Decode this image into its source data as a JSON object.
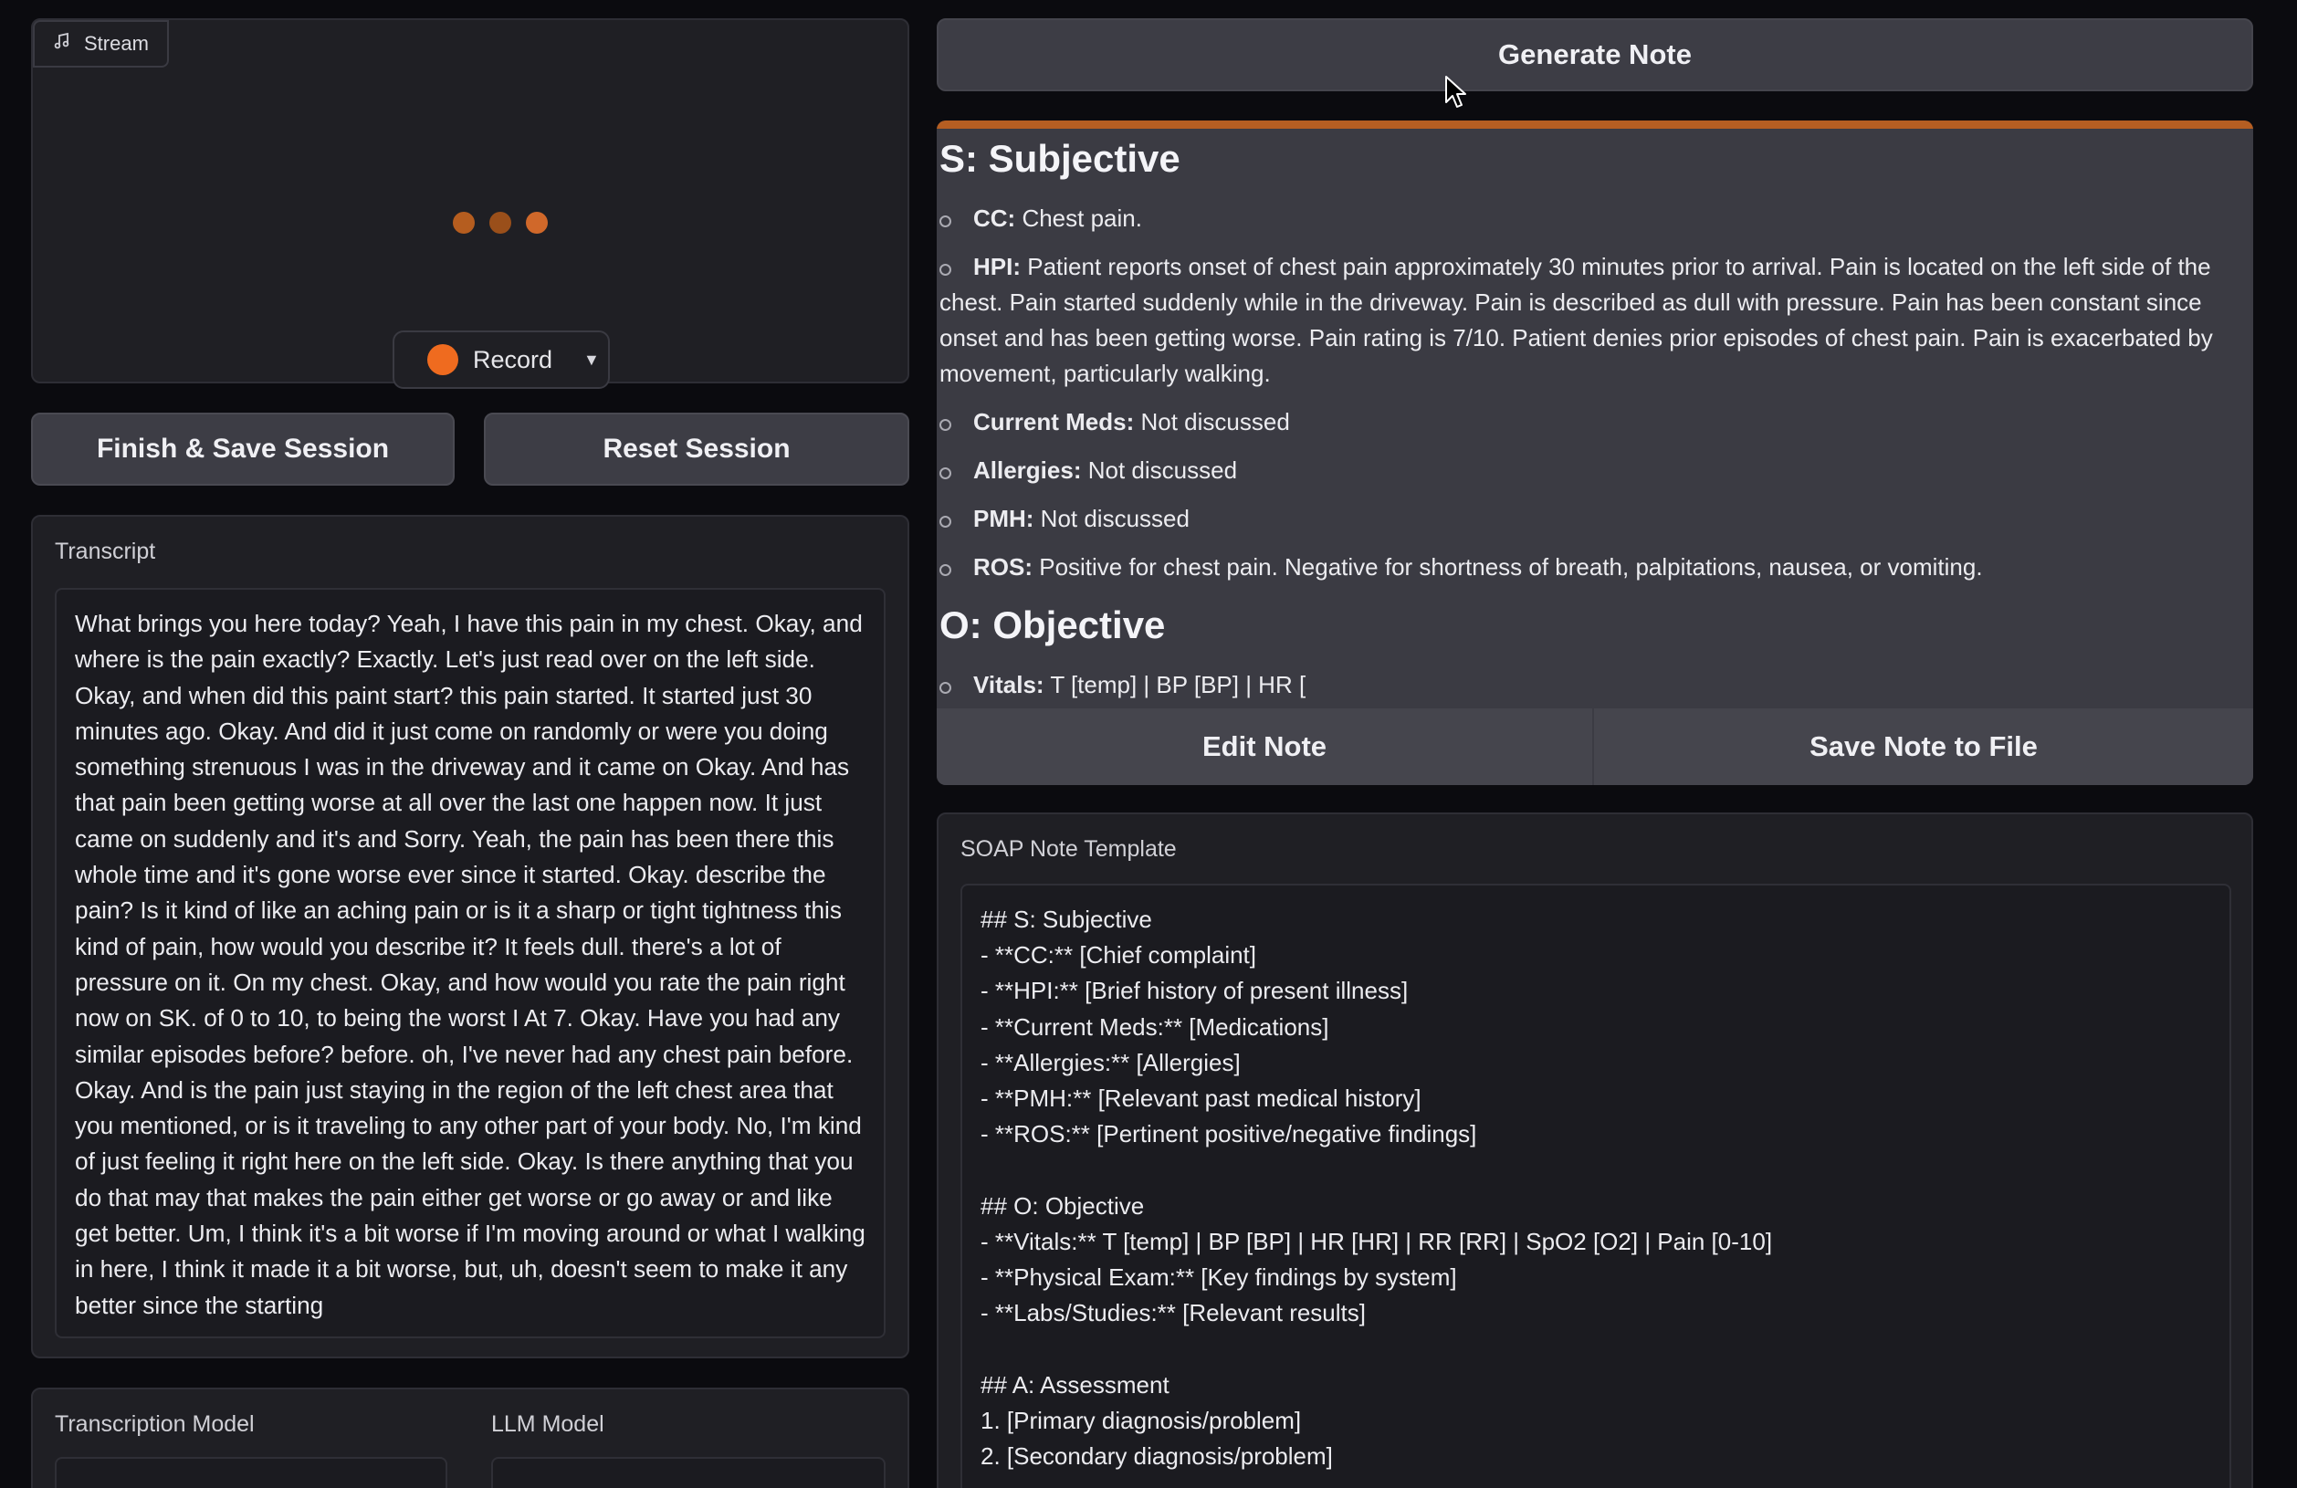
{
  "stream": {
    "tab_label": "Stream",
    "tab_icon": "music-note-icon",
    "record_label": "Record",
    "record_color": "#ef6b1f"
  },
  "session": {
    "finish_label": "Finish & Save Session",
    "reset_label": "Reset Session"
  },
  "transcript": {
    "label": "Transcript",
    "text": "What brings you here today? Yeah, I have this pain in my chest. Okay, and where is the pain exactly? Exactly. Let's just read over on the left side. Okay, and when did this paint start? this pain started. It started just 30 minutes ago. Okay. And did it just come on randomly or were you doing something strenuous I was in the driveway and it came on Okay. And has that pain been getting worse at all over the last one happen now. It just came on suddenly and it's and Sorry. Yeah, the pain has been there this whole time and it's gone worse ever since it started. Okay. describe the pain? Is it kind of like an aching pain or is it a sharp or tight tightness this kind of pain, how would you describe it? It feels dull. there's a lot of pressure on it. On my chest. Okay, and how would you rate the pain right now on SK. of 0 to 10, to being the worst I At 7. Okay. Have you had any similar episodes before? before. oh, I've never had any chest pain before. Okay. And is the pain just staying in the region of the left chest area that you mentioned, or is it traveling to any other part of your body. No, I'm kind of just feeling it right here on the left side. Okay. Is there anything that you do that may that makes the pain either get worse or go away or and like get better. Um, I think it's a bit worse if I'm moving around or what I walking in here, I think it made it a bit worse, but, uh, doesn't seem to make it any better since the starting"
  },
  "models": {
    "transcription_label": "Transcription Model",
    "llm_label": "LLM Model"
  },
  "note": {
    "generate_label": "Generate Note",
    "accent_color": "#b55e22",
    "subjective_heading": "S: Subjective",
    "subjective_items": [
      {
        "key": "CC:",
        "value": " Chest pain."
      },
      {
        "key": "HPI:",
        "value": " Patient reports onset of chest pain approximately 30 minutes prior to arrival. Pain is located on the left side of the chest. Pain started suddenly while in the driveway. Pain is described as dull with pressure. Pain has been constant since onset and has been getting worse. Pain rating is 7/10. Patient denies prior episodes of chest pain. Pain is exacerbated by movement, particularly walking."
      },
      {
        "key": "Current Meds:",
        "value": " Not discussed"
      },
      {
        "key": "Allergies:",
        "value": " Not discussed"
      },
      {
        "key": "PMH:",
        "value": " Not discussed"
      },
      {
        "key": "ROS:",
        "value": " Positive for chest pain. Negative for shortness of breath, palpitations, nausea, or vomiting."
      }
    ],
    "objective_heading": "O: Objective",
    "objective_items": [
      {
        "key": "Vitals:",
        "value": " T [temp] | BP [BP] | HR ["
      }
    ],
    "edit_label": "Edit Note",
    "save_label": "Save Note to File"
  },
  "template": {
    "label": "SOAP Note Template",
    "text": "## S: Subjective\n- **CC:** [Chief complaint]\n- **HPI:** [Brief history of present illness]\n- **Current Meds:** [Medications]\n- **Allergies:** [Allergies]\n- **PMH:** [Relevant past medical history]\n- **ROS:** [Pertinent positive/negative findings]\n\n## O: Objective\n- **Vitals:** T [temp] | BP [BP] | HR [HR] | RR [RR] | SpO2 [O2] | Pain [0-10]\n- **Physical Exam:** [Key findings by system]\n- **Labs/Studies:** [Relevant results]\n\n## A: Assessment\n1. [Primary diagnosis/problem]\n2. [Secondary diagnosis/problem]"
  }
}
